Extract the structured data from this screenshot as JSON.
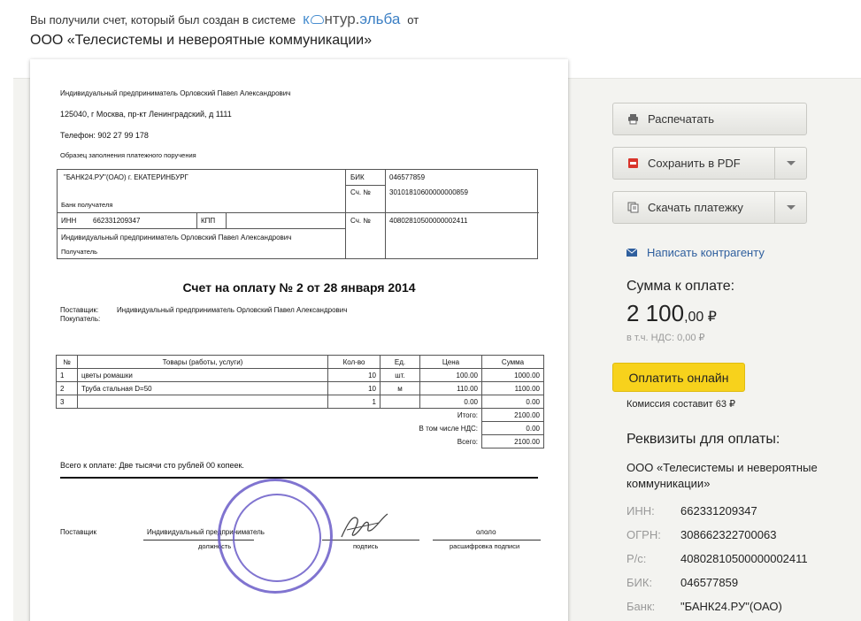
{
  "header": {
    "intro_text": "Вы получили счет, который был создан  в системе",
    "logo_text_k": "к",
    "logo_text_rest": "нтур.",
    "logo_text_brand": "эльба",
    "from_text": "от",
    "company_name": "ООО «Телесистемы и невероятные коммуникации»"
  },
  "invoice": {
    "seller_line": "Индивидуальный предприниматель Орловский Павел Александрович",
    "address": "125040, г Москва, пр-кт Ленинградский, д 1111",
    "phone": "Телефон: 902 27 99 178",
    "sample_caption": "Образец заполнения платежного поручения",
    "bank_name": "\"БАНК24.РУ\"(ОАО) г. ЕКАТЕРИНБУРГ",
    "bank_label": "Банк получателя",
    "bik_label": "БИК",
    "bik_value": "046577859",
    "corr_label": "Сч. №",
    "corr_value": "30101810600000000859",
    "inn_label": "ИНН",
    "inn_value": "662331209347",
    "kpp_label": "КПП",
    "acc_label": "Сч. №",
    "acc_value": "40802810500000002411",
    "recipient_name": "Индивидуальный предприниматель Орловский Павел Александрович",
    "recipient_label": "Получатель",
    "title": "Счет на оплату № 2 от 28 января 2014",
    "supplier_label": "Поставщик:",
    "supplier_value": "Индивидуальный предприниматель Орловский Павел Александрович",
    "buyer_label": "Покупатель:",
    "columns": [
      "№",
      "Товары (работы, услуги)",
      "Кол-во",
      "Ед.",
      "Цена",
      "Сумма"
    ],
    "rows": [
      [
        "1",
        "цветы ромашки",
        "10",
        "шт.",
        "100.00",
        "1000.00"
      ],
      [
        "2",
        "Труба стальная D=50",
        "10",
        "м",
        "110.00",
        "1100.00"
      ],
      [
        "3",
        "",
        "1",
        "",
        "0.00",
        "0.00"
      ]
    ],
    "total_label": "Итого:",
    "total_value": "2100.00",
    "vat_label": "В том числе НДС:",
    "vat_value": "0.00",
    "grand_label": "Всего:",
    "grand_value": "2100.00",
    "total_words": "Всего к оплате: Две тысячи сто рублей 00 копеек.",
    "sig_supplier": "Поставщик",
    "sig_position_value": "Индивидуальный предприниматель",
    "sig_position_label": "должность",
    "sig_signature_label": "подпись",
    "sig_name_value": "ололо",
    "sig_name_label": "расшифровка подписи",
    "stamp_text": "ИНН 662331209347 ОГРНИП 308662322700063 Индивидуальный предприниматель Орловский Павел Александрович"
  },
  "sidebar": {
    "print_label": "Распечатать",
    "pdf_label": "Сохранить в  PDF",
    "download_label": "Скачать платежку",
    "write_label": "Написать контрагенту",
    "sum_label": "Сумма к оплате:",
    "sum_main": "2 100",
    "sum_kop": ",00 ₽",
    "vat_note": "в т.ч. НДС: 0,00 ₽",
    "pay_label": "Оплатить онлайн",
    "commission": "Комиссия составит 63 ₽",
    "req_title": "Реквизиты для оплаты:",
    "req_company": "ООО «Телесистемы и невероятные",
    "req_company2": "коммуникации»",
    "req": [
      {
        "k": "ИНН:",
        "v": "662331209347"
      },
      {
        "k": "ОГРН:",
        "v": "308662322700063"
      },
      {
        "k": "Р/с:",
        "v": "40802810500000002411"
      },
      {
        "k": "БИК:",
        "v": "046577859"
      },
      {
        "k": "Банк:",
        "v": "\"БАНК24.РУ\"(ОАО)"
      }
    ]
  },
  "colors": {
    "accent": "#3b7fc4",
    "pay_button": "#f7d21c",
    "stamp": "#6a5cc8",
    "panel": "#f3f3f0"
  }
}
